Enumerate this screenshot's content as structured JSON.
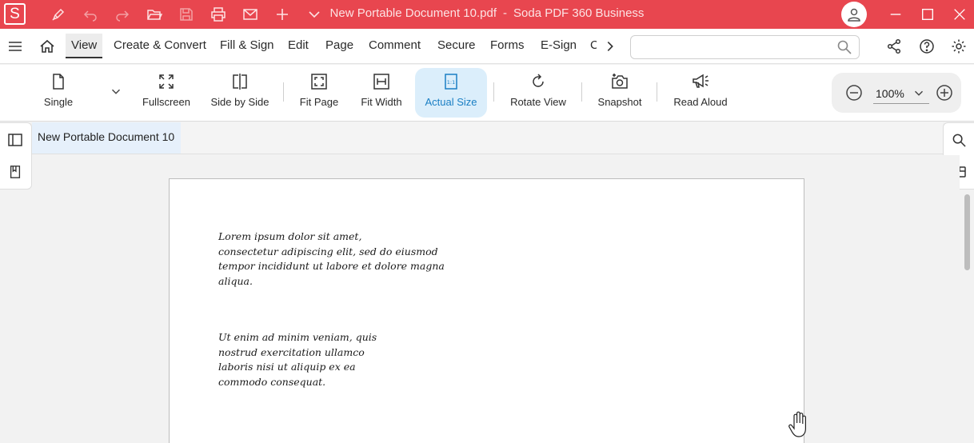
{
  "app": {
    "logo_letter": "S",
    "document_title": "New Portable Document 10.pdf",
    "separator": "-",
    "product_name": "Soda PDF 360 Business",
    "brand_color": "#e8464f"
  },
  "quick_access": [
    "pen-icon",
    "undo-icon",
    "redo-icon",
    "open-folder-icon",
    "save-icon",
    "print-icon",
    "mail-icon",
    "add-icon",
    "chevron-down-icon"
  ],
  "menu": {
    "tabs": [
      {
        "label": "View",
        "active": true
      },
      {
        "label": "Create & Convert"
      },
      {
        "label": "Fill & Sign"
      },
      {
        "label": "Edit"
      },
      {
        "label": "Page"
      },
      {
        "label": "Comment"
      },
      {
        "label": "Secure"
      },
      {
        "label": "Forms"
      },
      {
        "label": "E-Sign"
      },
      {
        "label": "C"
      }
    ],
    "search_placeholder": "",
    "search_value": ""
  },
  "toolbar": {
    "tools": [
      {
        "label": "Single",
        "icon": "page-icon"
      },
      {
        "label": "Fullscreen",
        "icon": "fullscreen-icon"
      },
      {
        "label": "Side by Side",
        "icon": "side-by-side-icon"
      },
      {
        "label": "Fit Page",
        "icon": "fit-page-icon"
      },
      {
        "label": "Fit Width",
        "icon": "fit-width-icon"
      },
      {
        "label": "Actual Size",
        "icon": "actual-size-icon",
        "active": true
      },
      {
        "label": "Rotate View",
        "icon": "rotate-icon"
      },
      {
        "label": "Snapshot",
        "icon": "camera-icon"
      },
      {
        "label": "Read Aloud",
        "icon": "megaphone-icon"
      }
    ],
    "zoom": "100%",
    "active_color": "#1a7fc4"
  },
  "document": {
    "tab_label": "New Portable Document 10",
    "paragraphs": [
      [
        "Lorem ipsum dolor sit amet,",
        "consectetur adipiscing elit, sed do eiusmod",
        "tempor incididunt ut labore et dolore magna",
        "aliqua."
      ],
      [
        "Ut enim ad minim veniam, quis",
        "nostrud exercitation ullamco",
        "laboris nisi ut aliquip ex ea",
        "commodo consequat."
      ]
    ]
  }
}
